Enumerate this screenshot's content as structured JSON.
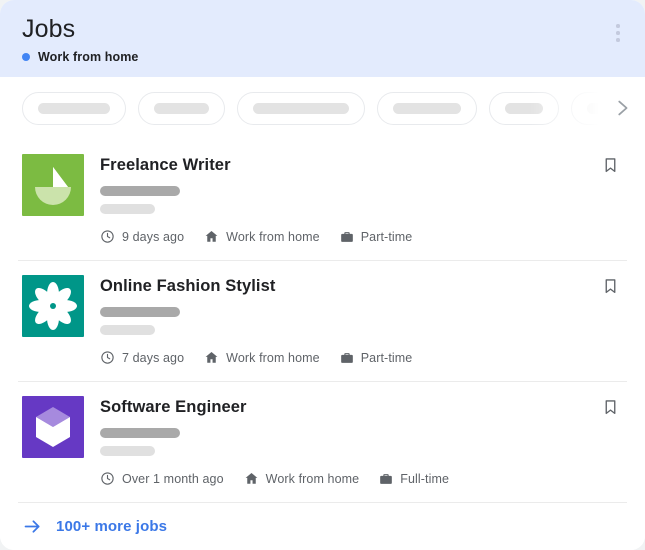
{
  "header": {
    "title": "Jobs",
    "subtitle": "Work from home",
    "dot_color": "#4285f4",
    "background": "#e3ebfd",
    "menu_icon": "kebab-menu-icon"
  },
  "filters": {
    "next_icon": "chevron-right-icon",
    "chips": [
      {
        "skeleton_width": 72
      },
      {
        "skeleton_width": 55
      },
      {
        "skeleton_width": 96
      },
      {
        "skeleton_width": 68
      },
      {
        "skeleton_width": 38
      },
      {
        "skeleton_width": 78
      }
    ]
  },
  "jobs": [
    {
      "title": "Freelance Writer",
      "logo": "sailboat-logo",
      "logo_color": "#7cbb42",
      "posted": "9 days ago",
      "location": "Work from home",
      "job_type": "Part-time",
      "posted_icon": "clock-icon",
      "location_icon": "home-icon",
      "type_icon": "briefcase-icon",
      "bookmark_icon": "bookmark-icon"
    },
    {
      "title": "Online Fashion Stylist",
      "logo": "flower-logo",
      "logo_color": "#009688",
      "posted": "7 days ago",
      "location": "Work from home",
      "job_type": "Part-time",
      "posted_icon": "clock-icon",
      "location_icon": "home-icon",
      "type_icon": "briefcase-icon",
      "bookmark_icon": "bookmark-icon"
    },
    {
      "title": "Software Engineer",
      "logo": "cube-logo",
      "logo_color": "#6639c4",
      "posted": "Over 1 month ago",
      "location": "Work from home",
      "job_type": "Full-time",
      "posted_icon": "clock-icon",
      "location_icon": "home-icon",
      "type_icon": "briefcase-icon",
      "bookmark_icon": "bookmark-icon"
    }
  ],
  "footer": {
    "label": "100+ more jobs",
    "arrow_icon": "arrow-right-icon",
    "link_color": "#3b78e7"
  }
}
